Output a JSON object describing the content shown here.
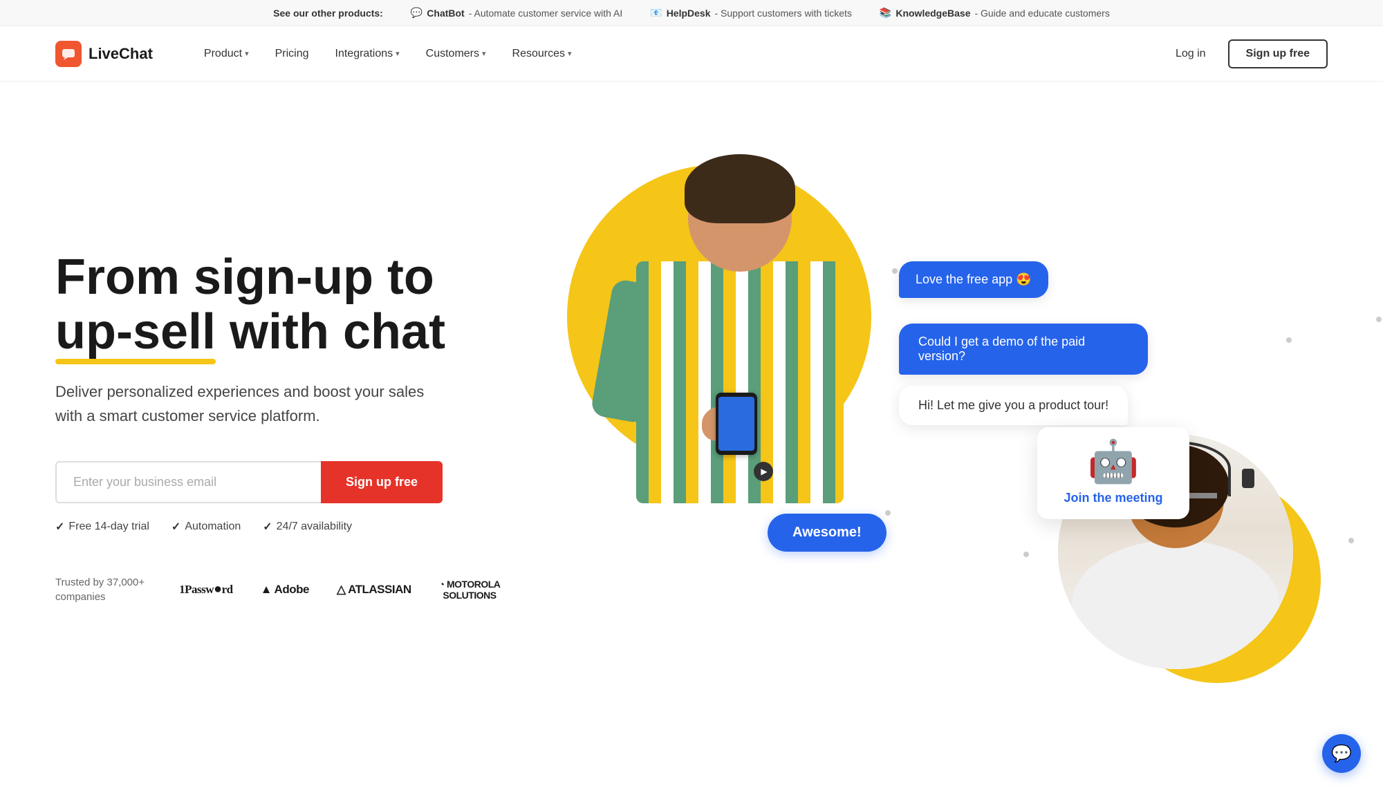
{
  "topbar": {
    "see_other": "See our other products:",
    "products": [
      {
        "icon": "💬",
        "name": "ChatBot",
        "desc": "- Automate customer service with AI"
      },
      {
        "icon": "📧",
        "name": "HelpDesk",
        "desc": "- Support customers with tickets"
      },
      {
        "icon": "📚",
        "name": "KnowledgeBase",
        "desc": "- Guide and educate customers"
      }
    ]
  },
  "nav": {
    "logo_text": "LiveChat",
    "items": [
      {
        "label": "Product",
        "has_dropdown": true
      },
      {
        "label": "Pricing",
        "has_dropdown": false
      },
      {
        "label": "Integrations",
        "has_dropdown": true
      },
      {
        "label": "Customers",
        "has_dropdown": true
      },
      {
        "label": "Resources",
        "has_dropdown": true
      }
    ],
    "login_label": "Log in",
    "signup_label": "Sign up free"
  },
  "hero": {
    "title_line1": "From sign-up to",
    "title_line2": "up-sell",
    "title_line3": "with chat",
    "underline_word": "up-sell",
    "subtitle": "Deliver personalized experiences and boost your sales with a smart customer service platform.",
    "email_placeholder": "Enter your business email",
    "signup_button": "Sign up free",
    "checks": [
      {
        "label": "Free 14-day trial"
      },
      {
        "label": "Automation"
      },
      {
        "label": "24/7 availability"
      }
    ],
    "trusted_label": "Trusted by 37,000+\ncompanies",
    "trusted_logos": [
      "1Password",
      "Adobe",
      "ATLASSIAN",
      "MOTOROLA\nSOLUTIONS"
    ]
  },
  "chat_bubbles": {
    "bubble1": "Love the free app 😍",
    "bubble2": "Could I get a demo of the paid version?",
    "bubble3": "Hi! Let me give you a product tour!",
    "bubble_awesome": "Awesome!"
  },
  "agent_card": {
    "join_text": "Join the meeting"
  },
  "chat_widget": {
    "icon": "💬"
  }
}
